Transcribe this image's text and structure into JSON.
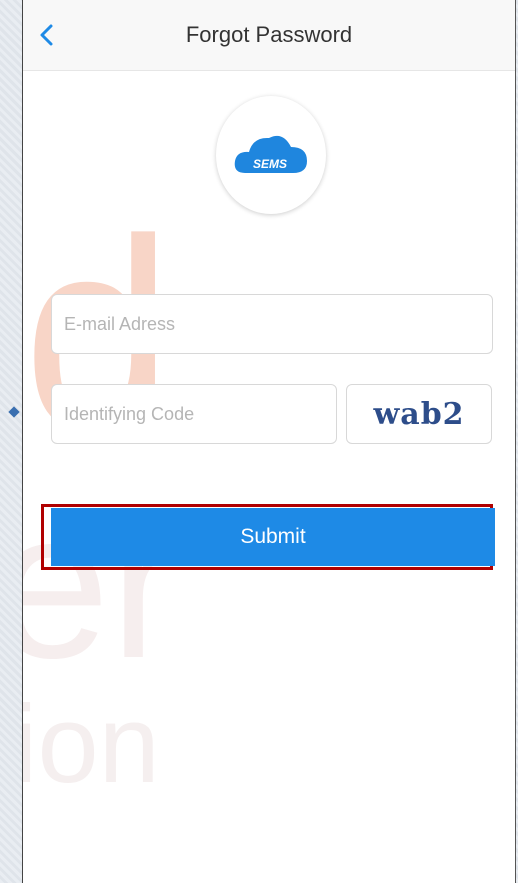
{
  "header": {
    "title": "Forgot Password"
  },
  "logo": {
    "text": "SEMS"
  },
  "form": {
    "email_placeholder": "E-mail Adress",
    "code_placeholder": "Identifying Code",
    "captcha_text": "wab2",
    "submit_label": "Submit"
  },
  "colors": {
    "accent": "#1e8ae6",
    "highlight_border": "#b00000"
  },
  "icons": {
    "back": "chevron-left-icon",
    "logo": "cloud-icon"
  }
}
